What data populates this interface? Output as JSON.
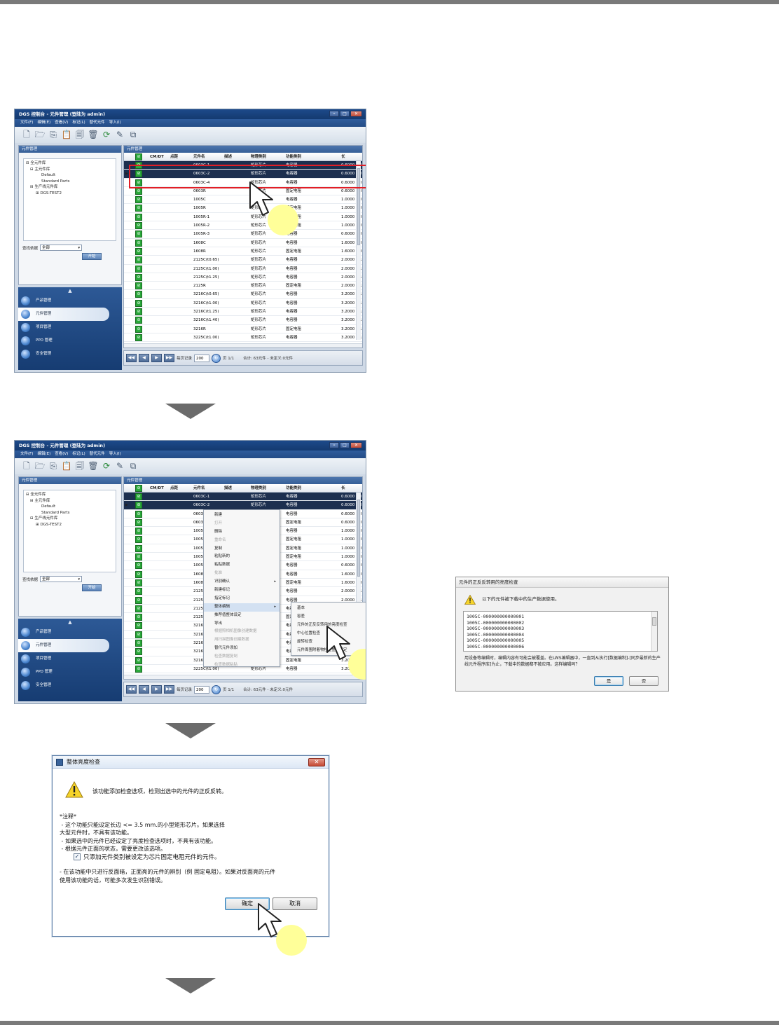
{
  "app": {
    "title": "DGS 控制台 - 元件管理 (登陆为 admin)",
    "window_buttons": [
      "–",
      "□",
      "✕"
    ],
    "menu": [
      "文件(F)",
      "编辑(E)",
      "查看(V)",
      "标记(L)",
      "替代元件",
      "导入(I)"
    ],
    "toolbar_icons": [
      "new-icon",
      "open-folder-icon",
      "copy-icon",
      "paste-icon",
      "delete-icon",
      "recycle-icon",
      "refresh-icon",
      "edit-icon",
      "import-icon"
    ],
    "left_panel_title": "元件管理",
    "tree": [
      {
        "text": "⊟ 全元件库",
        "indent": 0
      },
      {
        "text": "⊟ 主元件库",
        "indent": 1
      },
      {
        "text": "Default",
        "indent": 2
      },
      {
        "text": "Standard Parts",
        "indent": 2
      },
      {
        "text": "⊟ 生产线元件库",
        "indent": 1
      },
      {
        "text": "⊞ DGS-TEST2",
        "indent": 2
      }
    ],
    "search_label": "查找依据",
    "search_value": "全部",
    "start_button": "开始",
    "nav_items": [
      "产品管理",
      "元件管理",
      "项目管理",
      "PPD 管理",
      "安全管理"
    ],
    "nav_active": 1,
    "main_panel_title": "元件管理",
    "columns": [
      "CM/DT",
      "点距",
      "元件名",
      "描述",
      "物理类别",
      "功能类别",
      "长"
    ],
    "rows": [
      [
        "0603C-1",
        "矩形芯片",
        "电容器",
        "0.6000",
        "0"
      ],
      [
        "0603C-2",
        "矩形芯片",
        "电容器",
        "0.6000",
        "0"
      ],
      [
        "0603C-4",
        "矩形芯片",
        "电容器",
        "0.6000",
        "0"
      ],
      [
        "0603R",
        "矩形芯片",
        "固定电阻",
        "0.6000",
        "0"
      ],
      [
        "1005C",
        "矩形芯片",
        "电容器",
        "1.0000",
        "0"
      ],
      [
        "1005R",
        "矩形芯片",
        "固定电阻",
        "1.0000",
        "0"
      ],
      [
        "1005R-1",
        "矩形芯片",
        "固定电阻",
        "1.0000",
        "0"
      ],
      [
        "1005R-2",
        "矩形芯片",
        "固定电阻",
        "1.0000",
        "0"
      ],
      [
        "1005R-3",
        "矩形芯片",
        "电容器",
        "0.6000",
        "0"
      ],
      [
        "1608C",
        "矩形芯片",
        "电容器",
        "1.6000",
        "0"
      ],
      [
        "1608R",
        "矩形芯片",
        "固定电阻",
        "1.6000",
        "0"
      ],
      [
        "2125C(t0.65)",
        "矩形芯片",
        "电容器",
        "2.0000",
        "1"
      ],
      [
        "2125C(t1.00)",
        "矩形芯片",
        "电容器",
        "2.0000",
        "1"
      ],
      [
        "2125C(t1.25)",
        "矩形芯片",
        "电容器",
        "2.0000",
        "1"
      ],
      [
        "2125R",
        "矩形芯片",
        "固定电阻",
        "2.0000",
        "1"
      ],
      [
        "3216C(t0.65)",
        "矩形芯片",
        "电容器",
        "3.2000",
        "1"
      ],
      [
        "3216C(t1.00)",
        "矩形芯片",
        "电容器",
        "3.2000",
        "1"
      ],
      [
        "3216C(t1.25)",
        "矩形芯片",
        "电容器",
        "3.2000",
        "1"
      ],
      [
        "3216C(t1.40)",
        "矩形芯片",
        "电容器",
        "3.2000",
        "1"
      ],
      [
        "3216R",
        "矩形芯片",
        "固定电阻",
        "3.2000",
        "1"
      ],
      [
        "3225C(t1.00)",
        "矩形芯片",
        "电容器",
        "3.2000",
        "1"
      ]
    ],
    "selected_rows": [
      0,
      1
    ],
    "pager": {
      "first": "◀◀",
      "prev": "◀",
      "next": "▶",
      "last": "▶▶",
      "page_size_label": "每页记录",
      "page_size": "200",
      "page_info": "页 1/1",
      "total": "合计: 63元件 - 未定义:0元件"
    }
  },
  "context_menu": {
    "items": [
      {
        "label": "新建",
        "disabled": false
      },
      {
        "label": "打开",
        "disabled": true
      },
      {
        "label": "删除",
        "disabled": false
      },
      {
        "label": "重命名",
        "disabled": true
      },
      {
        "label": "复制",
        "disabled": false
      },
      {
        "label": "粘贴新的",
        "disabled": false
      },
      {
        "label": "粘贴数据",
        "disabled": false
      },
      {
        "label": "批准",
        "disabled": true
      },
      {
        "label": "识别确认",
        "disabled": false,
        "submenu": true
      },
      {
        "label": "新建标记",
        "disabled": false
      },
      {
        "label": "指定标记",
        "disabled": false
      },
      {
        "label": "整体编辑",
        "disabled": false,
        "submenu": true,
        "highlight": true
      },
      {
        "label": "推荐值整体设定",
        "disabled": false
      },
      {
        "label": "导出",
        "disabled": false
      },
      {
        "label": "根据照相机图像创建数据",
        "disabled": true
      },
      {
        "label": "用扫描图像创建数据",
        "disabled": true
      },
      {
        "label": "替代元件添加",
        "disabled": false
      },
      {
        "label": "检查数据复制",
        "disabled": true
      },
      {
        "label": "检查数据粘贴",
        "disabled": true
      }
    ],
    "submenu": [
      "基本",
      "容差",
      "元件的正反反转用的亮度检查",
      "中心位置检查",
      "旋转检查",
      "元件周围附着物检查整体设定"
    ]
  },
  "warning_dialog": {
    "title": "元件的正反反转用的亮度检查",
    "message": "以下的元件被下载中的生产数据使用。",
    "items": [
      "1005C-000000000000001",
      "1005C-000000000000002",
      "1005C-000000000000003",
      "1005C-000000000000004",
      "1005C-000000000000005",
      "1005C-000000000000006"
    ],
    "note": "用设备等编辑时，编辑内容有可能会被覆盖。在LWS编辑器中，一直到从执行[数据编制]-[同步最新的生产线元件程序库]为止，下载中的数据都不被应用。这样编辑吗？",
    "yes": "是",
    "no": "否"
  },
  "overall_dialog": {
    "title": "整体亮度检查",
    "close": "✕",
    "lead": "该功能添加检查选项，检测出选中的元件的正反反转。",
    "notes": [
      "*注释*",
      " - 这个功能只能设定长边 <= 3.5 mm.的小型矩形芯片。如果选择",
      "大型元件时，不具有该功能。",
      " - 如果选中的元件已经设定了亮度检查选项时，不具有该功能。",
      " - 根据元件正面的状态，需要更改该选项。"
    ],
    "checkbox_label": "只添加元件类别被设定为芯片固定电阻元件的元件。",
    "checkbox_checked": "✓",
    "notes2": [
      "- 在该功能中只进行反面暗，正面亮的元件的辨别（例 固定电阻）。如果对反面亮的元件",
      "使用该功能的话，可能多次发生识别错误。"
    ],
    "ok": "确定",
    "cancel": "取消"
  },
  "colors": {
    "selection": "#1c2f4f",
    "highlight_box": "#e11e26",
    "callout": "#ffff99"
  }
}
